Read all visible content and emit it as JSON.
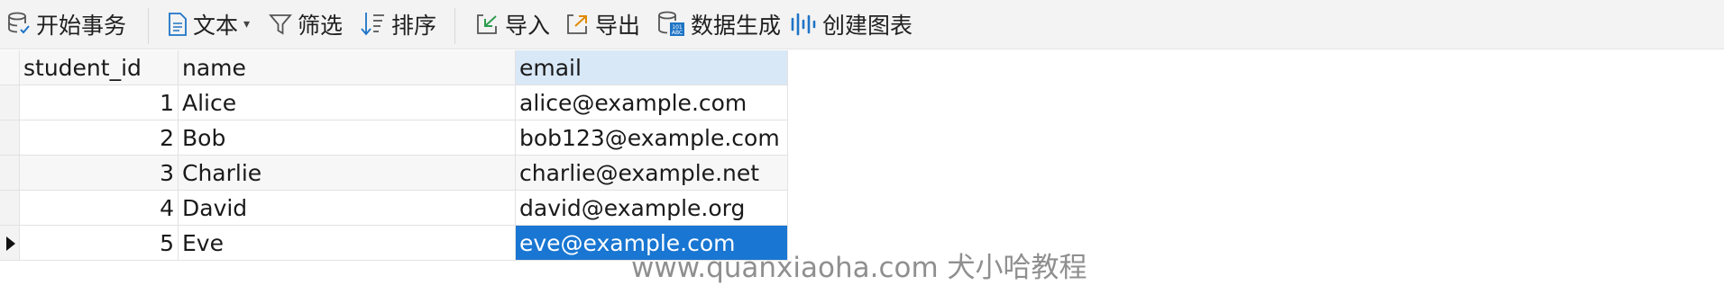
{
  "toolbar": {
    "begin_transaction": "开始事务",
    "text": "文本",
    "filter": "筛选",
    "sort": "排序",
    "import": "导入",
    "export": "导出",
    "generate_data": "数据生成",
    "create_chart": "创建图表"
  },
  "table": {
    "columns": [
      "student_id",
      "name",
      "email"
    ],
    "rows": [
      {
        "student_id": "1",
        "name": "Alice",
        "email": "alice@example.com"
      },
      {
        "student_id": "2",
        "name": "Bob",
        "email": "bob123@example.com"
      },
      {
        "student_id": "3",
        "name": "Charlie",
        "email": "charlie@example.net"
      },
      {
        "student_id": "4",
        "name": "David",
        "email": "david@example.org"
      },
      {
        "student_id": "5",
        "name": "Eve",
        "email": "eve@example.com"
      }
    ],
    "current_row": 5,
    "selected_cell": {
      "row": 5,
      "column": "email"
    }
  },
  "watermark": "www.quanxiaoha.com 犬小哈教程",
  "colors": {
    "toolbar_bg": "#f3f3f3",
    "selection": "#1976d2",
    "header_selected": "#d9e8f7",
    "icon_blue": "#1e74c6"
  }
}
